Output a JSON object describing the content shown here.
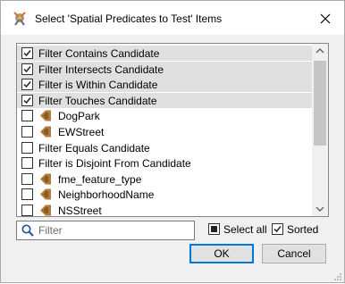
{
  "dialog": {
    "title": "Select 'Spatial Predicates to Test' Items",
    "close_glyph": "✕"
  },
  "items": [
    {
      "label": "Filter Contains Candidate",
      "checked": true,
      "selected": true,
      "icon": null
    },
    {
      "label": "Filter Intersects Candidate",
      "checked": true,
      "selected": true,
      "icon": null
    },
    {
      "label": "Filter is Within Candidate",
      "checked": true,
      "selected": true,
      "icon": null
    },
    {
      "label": "Filter Touches Candidate",
      "checked": true,
      "selected": true,
      "icon": null
    },
    {
      "label": "DogPark",
      "checked": false,
      "selected": false,
      "icon": "feature-port-icon"
    },
    {
      "label": "EWStreet",
      "checked": false,
      "selected": false,
      "icon": "feature-port-icon"
    },
    {
      "label": "Filter Equals Candidate",
      "checked": false,
      "selected": false,
      "icon": null
    },
    {
      "label": "Filter is Disjoint From Candidate",
      "checked": false,
      "selected": false,
      "icon": null
    },
    {
      "label": "fme_feature_type",
      "checked": false,
      "selected": false,
      "icon": "feature-port-icon"
    },
    {
      "label": "NeighborhoodName",
      "checked": false,
      "selected": false,
      "icon": "feature-port-icon"
    },
    {
      "label": "NSStreet",
      "checked": false,
      "selected": false,
      "icon": "feature-port-icon"
    }
  ],
  "filter": {
    "placeholder": "Filter",
    "value": ""
  },
  "options": {
    "select_all_label": "Select all",
    "select_all_state": "indeterminate",
    "sorted_label": "Sorted",
    "sorted_checked": true
  },
  "buttons": {
    "ok": "OK",
    "cancel": "Cancel"
  },
  "colors": {
    "accent": "#0078d7",
    "selection": "#e0e0e0",
    "port_icon": "#b07a3a"
  }
}
